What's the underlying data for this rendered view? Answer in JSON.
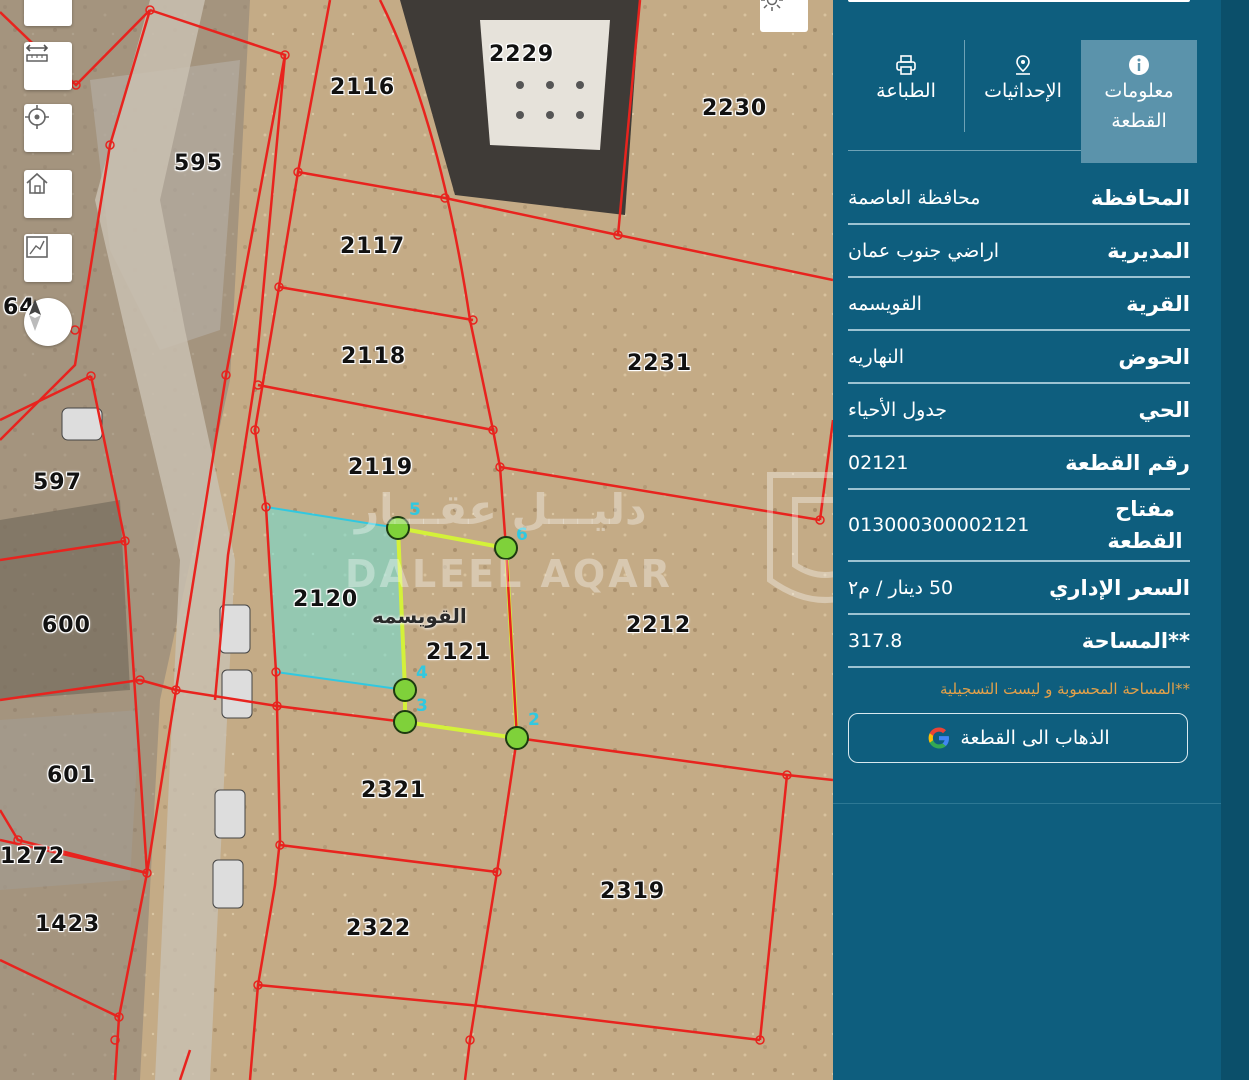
{
  "map": {
    "plots": [
      {
        "id": "2229",
        "label": "2229"
      },
      {
        "id": "2116",
        "label": "2116"
      },
      {
        "id": "2230",
        "label": "2230"
      },
      {
        "id": "595",
        "label": "595"
      },
      {
        "id": "2117",
        "label": "2117"
      },
      {
        "id": "64",
        "label": "64"
      },
      {
        "id": "2118",
        "label": "2118"
      },
      {
        "id": "2231",
        "label": "2231"
      },
      {
        "id": "2119",
        "label": "2119"
      },
      {
        "id": "597",
        "label": "597"
      },
      {
        "id": "2120",
        "label": "2120"
      },
      {
        "id": "600",
        "label": "600"
      },
      {
        "id": "2212",
        "label": "2212"
      },
      {
        "id": "2121",
        "label": "2121"
      },
      {
        "id": "601",
        "label": "601"
      },
      {
        "id": "2321",
        "label": "2321"
      },
      {
        "id": "1272",
        "label": "1272"
      },
      {
        "id": "2319",
        "label": "2319"
      },
      {
        "id": "1423",
        "label": "1423"
      },
      {
        "id": "2322",
        "label": "2322"
      }
    ],
    "region_label": "القويسمه",
    "vertices": [
      "5",
      "6",
      "4",
      "3",
      "2"
    ],
    "watermark_ar": "دليـــل عقـــار",
    "watermark_en": "DALEEL AQAR",
    "tools": [
      "edit-icon",
      "measure-icon",
      "locate-icon",
      "home-icon",
      "draw-icon",
      "compass-icon",
      "brightness-icon"
    ],
    "colors": {
      "parcel_lines": "#e8231e",
      "selected_parcel": "#d4f13a",
      "highlighted_parcel": "#6de0d6",
      "vertex_marker": "#7fd13a"
    }
  },
  "panel": {
    "tabs": [
      {
        "label": "معلومات القطعة",
        "icon": "info-icon",
        "active": true
      },
      {
        "label": "الإحداثيات",
        "icon": "pin-icon",
        "active": false
      },
      {
        "label": "الطباعة",
        "icon": "printer-icon",
        "active": false
      }
    ],
    "rows": [
      {
        "key": "المحافظة",
        "value": "محافظة العاصمة"
      },
      {
        "key": "المديرية",
        "value": "اراضي جنوب عمان"
      },
      {
        "key": "القرية",
        "value": "القويسمه"
      },
      {
        "key": "الحوض",
        "value": "النهاريه"
      },
      {
        "key": "الحي",
        "value": "جدول الأحياء"
      },
      {
        "key": "رقم القطعة",
        "value": "02121"
      },
      {
        "key": "مفتاح القطعة",
        "value": "013000300002121"
      },
      {
        "key": "السعر الإداري",
        "value": "50 دينار / م٢"
      },
      {
        "key": "**المساحة",
        "value": "317.8"
      }
    ],
    "note": "**المساحة المحسوبة و ليست التسجيلية",
    "goto_button": "الذهاب الى القطعة"
  }
}
